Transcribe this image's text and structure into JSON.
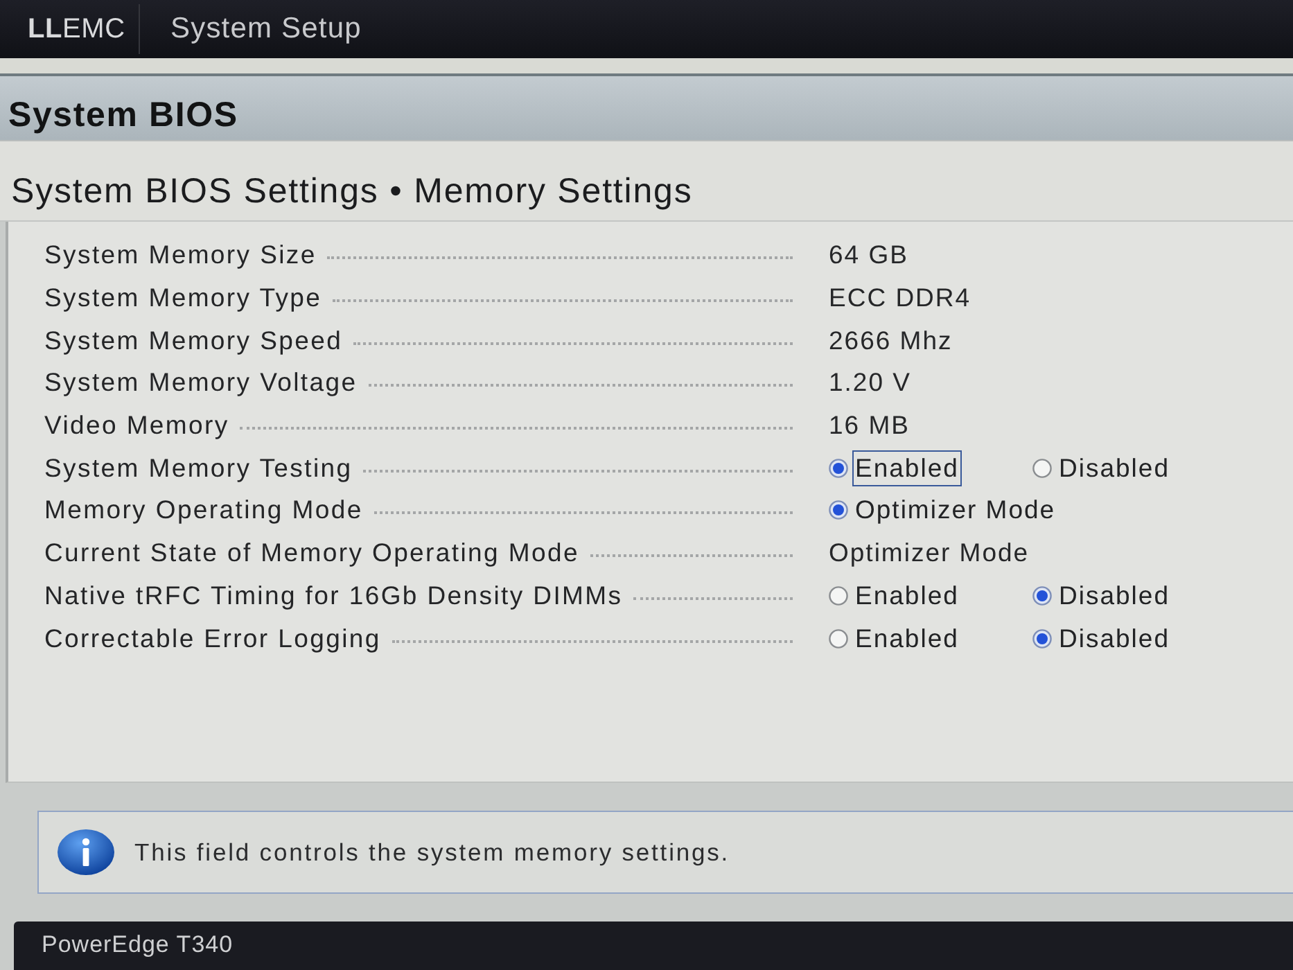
{
  "header": {
    "logo": "**LL**EMC",
    "title": "System Setup"
  },
  "page_title": "System BIOS",
  "section_title": "System BIOS Settings • Memory Settings",
  "settings": [
    {
      "kind": "value",
      "label": "System Memory Size",
      "value": "64 GB"
    },
    {
      "kind": "value",
      "label": "System Memory Type",
      "value": "ECC DDR4"
    },
    {
      "kind": "value",
      "label": "System Memory Speed",
      "value": "2666 Mhz"
    },
    {
      "kind": "value",
      "label": "System Memory Voltage",
      "value": "1.20 V"
    },
    {
      "kind": "value",
      "label": "Video Memory",
      "value": "16 MB"
    },
    {
      "kind": "radio",
      "label": "System Memory Testing",
      "options": [
        {
          "label": "Enabled",
          "selected": true,
          "focused": true
        },
        {
          "label": "Disabled",
          "selected": false,
          "focused": false
        }
      ]
    },
    {
      "kind": "radio",
      "label": "Memory Operating Mode",
      "options": [
        {
          "label": "Optimizer Mode",
          "selected": true,
          "focused": false
        }
      ]
    },
    {
      "kind": "value",
      "label": "Current State of Memory Operating Mode",
      "value": "Optimizer Mode"
    },
    {
      "kind": "radio",
      "label": "Native tRFC Timing for 16Gb Density DIMMs",
      "options": [
        {
          "label": "Enabled",
          "selected": false,
          "focused": false
        },
        {
          "label": "Disabled",
          "selected": true,
          "focused": false
        }
      ]
    },
    {
      "kind": "radio",
      "label": "Correctable Error Logging",
      "options": [
        {
          "label": "Enabled",
          "selected": false,
          "focused": false
        },
        {
          "label": "Disabled",
          "selected": true,
          "focused": false
        }
      ]
    }
  ],
  "help": {
    "text": "This field controls the system memory settings."
  },
  "footer": {
    "model": "PowerEdge T340"
  }
}
